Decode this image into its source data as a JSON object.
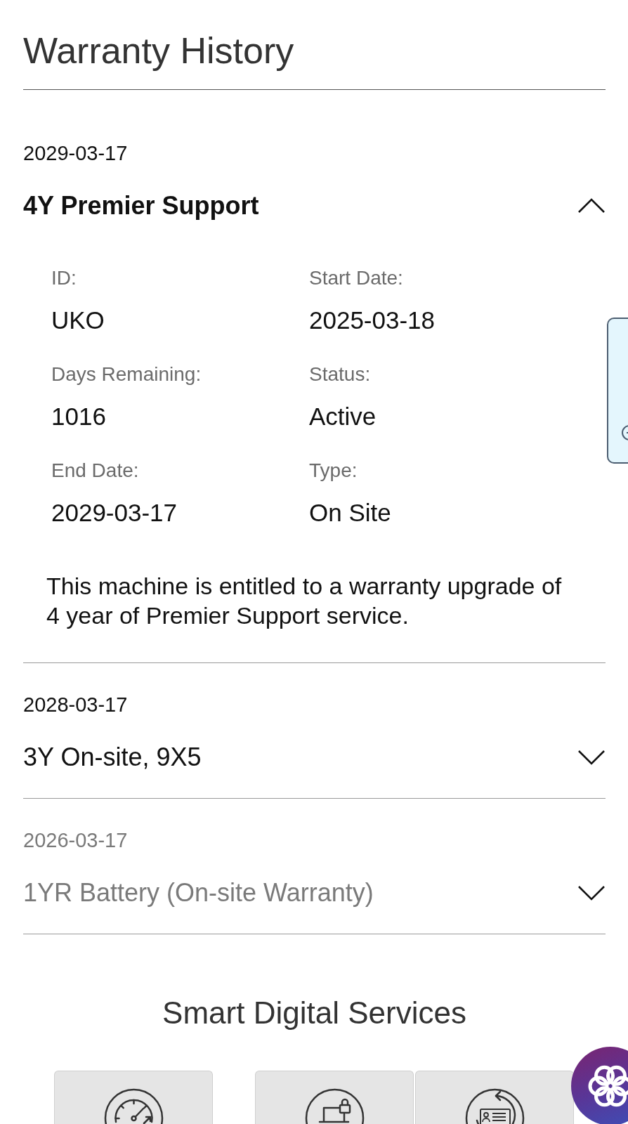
{
  "page": {
    "title": "Warranty History"
  },
  "warranties": [
    {
      "date": "2029-03-17",
      "name": "4Y Premier Support",
      "expanded": true,
      "inactive": false,
      "details": [
        {
          "label": "ID:",
          "value": "UKO"
        },
        {
          "label": "Start Date:",
          "value": "2025-03-18"
        },
        {
          "label": "Days Remaining:",
          "value": "1016"
        },
        {
          "label": "Status:",
          "value": "Active"
        },
        {
          "label": "End Date:",
          "value": "2029-03-17"
        },
        {
          "label": "Type:",
          "value": "On Site"
        }
      ],
      "description": "This machine is entitled to a warranty upgrade of 4 year of Premier Support service."
    },
    {
      "date": "2028-03-17",
      "name": "3Y On-site, 9X5",
      "expanded": false,
      "inactive": false
    },
    {
      "date": "2026-03-17",
      "name": "1YR Battery (On-site Warranty)",
      "expanded": false,
      "inactive": true
    }
  ],
  "smart_digital_services": {
    "title": "Smart Digital Services"
  }
}
